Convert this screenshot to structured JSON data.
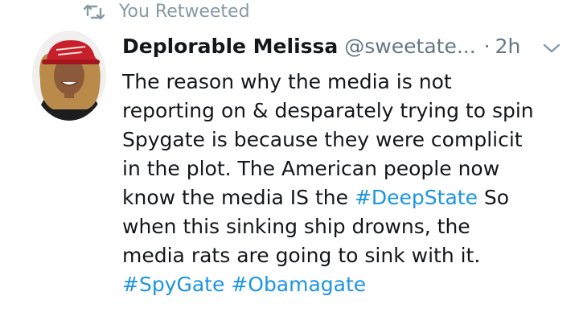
{
  "retweet": {
    "icon": "retweet-icon",
    "label": "You Retweeted"
  },
  "tweet": {
    "author_name": "Deplorable Melissa",
    "handle": "@sweetate...",
    "separator": "·",
    "time": "2h",
    "lines": [
      "The reason why the media is not",
      "reporting on & desparately trying to spin",
      "Spygate is because they were complicit",
      "in the plot. The American people now"
    ],
    "line5_before": "know the media IS the ",
    "hashtag_deepstate": "#DeepState",
    "line5_after": " So",
    "line6": "when this sinking ship drowns, the",
    "line7": "media rats are going to sink with it.",
    "hashtag_spygate": "#SpyGate",
    "hashtag_gap": " ",
    "hashtag_obamagate": "#Obamagate"
  },
  "icons": {
    "avatar": "avatar",
    "more_menu": "chevron-down-icon"
  },
  "colors": {
    "secondary_text": "#8899a6",
    "meta_text": "#657786",
    "primary_text": "#14171a",
    "hashtag": "#1b95e0",
    "background": "#ffffff"
  }
}
